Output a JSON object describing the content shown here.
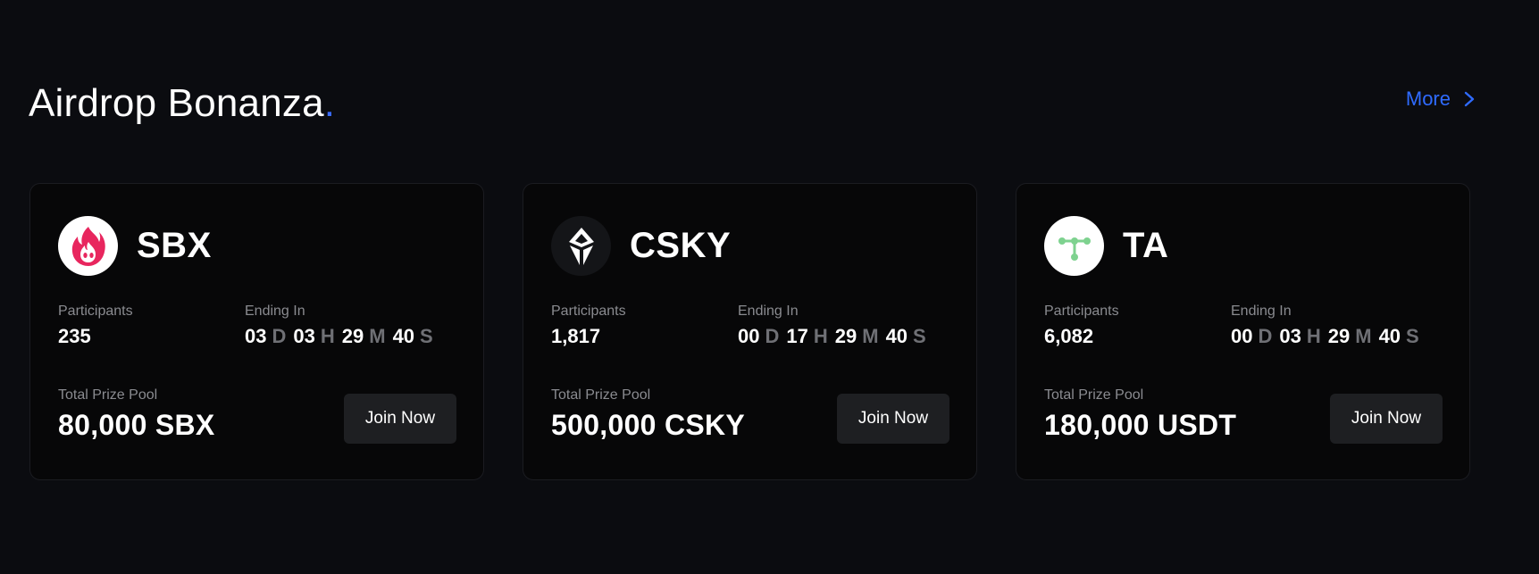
{
  "header": {
    "title": "Airdrop Bonanza",
    "title_dot": ".",
    "more_label": "More",
    "more_icon": "chevron-right-icon"
  },
  "colors": {
    "background": "#0b0c10",
    "card_background": "#070708",
    "accent": "#2f6bff",
    "muted": "#8a8b90",
    "button": "#1e1f22"
  },
  "cards": [
    {
      "token": "SBX",
      "logo_icon": "flame-icon",
      "participants_label": "Participants",
      "participants": "235",
      "ending_label": "Ending In",
      "countdown": {
        "days": "03",
        "days_unit": "D",
        "hours": "03",
        "hours_unit": "H",
        "minutes": "29",
        "minutes_unit": "M",
        "seconds": "40",
        "seconds_unit": "S"
      },
      "prize_label": "Total Prize Pool",
      "prize": "80,000 SBX",
      "button_label": "Join Now"
    },
    {
      "token": "CSKY",
      "logo_icon": "crystal-icon",
      "participants_label": "Participants",
      "participants": "1,817",
      "ending_label": "Ending In",
      "countdown": {
        "days": "00",
        "days_unit": "D",
        "hours": "17",
        "hours_unit": "H",
        "minutes": "29",
        "minutes_unit": "M",
        "seconds": "40",
        "seconds_unit": "S"
      },
      "prize_label": "Total Prize Pool",
      "prize": "500,000 CSKY",
      "button_label": "Join Now"
    },
    {
      "token": "TA",
      "logo_icon": "node-network-icon",
      "participants_label": "Participants",
      "participants": "6,082",
      "ending_label": "Ending In",
      "countdown": {
        "days": "00",
        "days_unit": "D",
        "hours": "03",
        "hours_unit": "H",
        "minutes": "29",
        "minutes_unit": "M",
        "seconds": "40",
        "seconds_unit": "S"
      },
      "prize_label": "Total Prize Pool",
      "prize": "180,000 USDT",
      "button_label": "Join Now"
    }
  ]
}
